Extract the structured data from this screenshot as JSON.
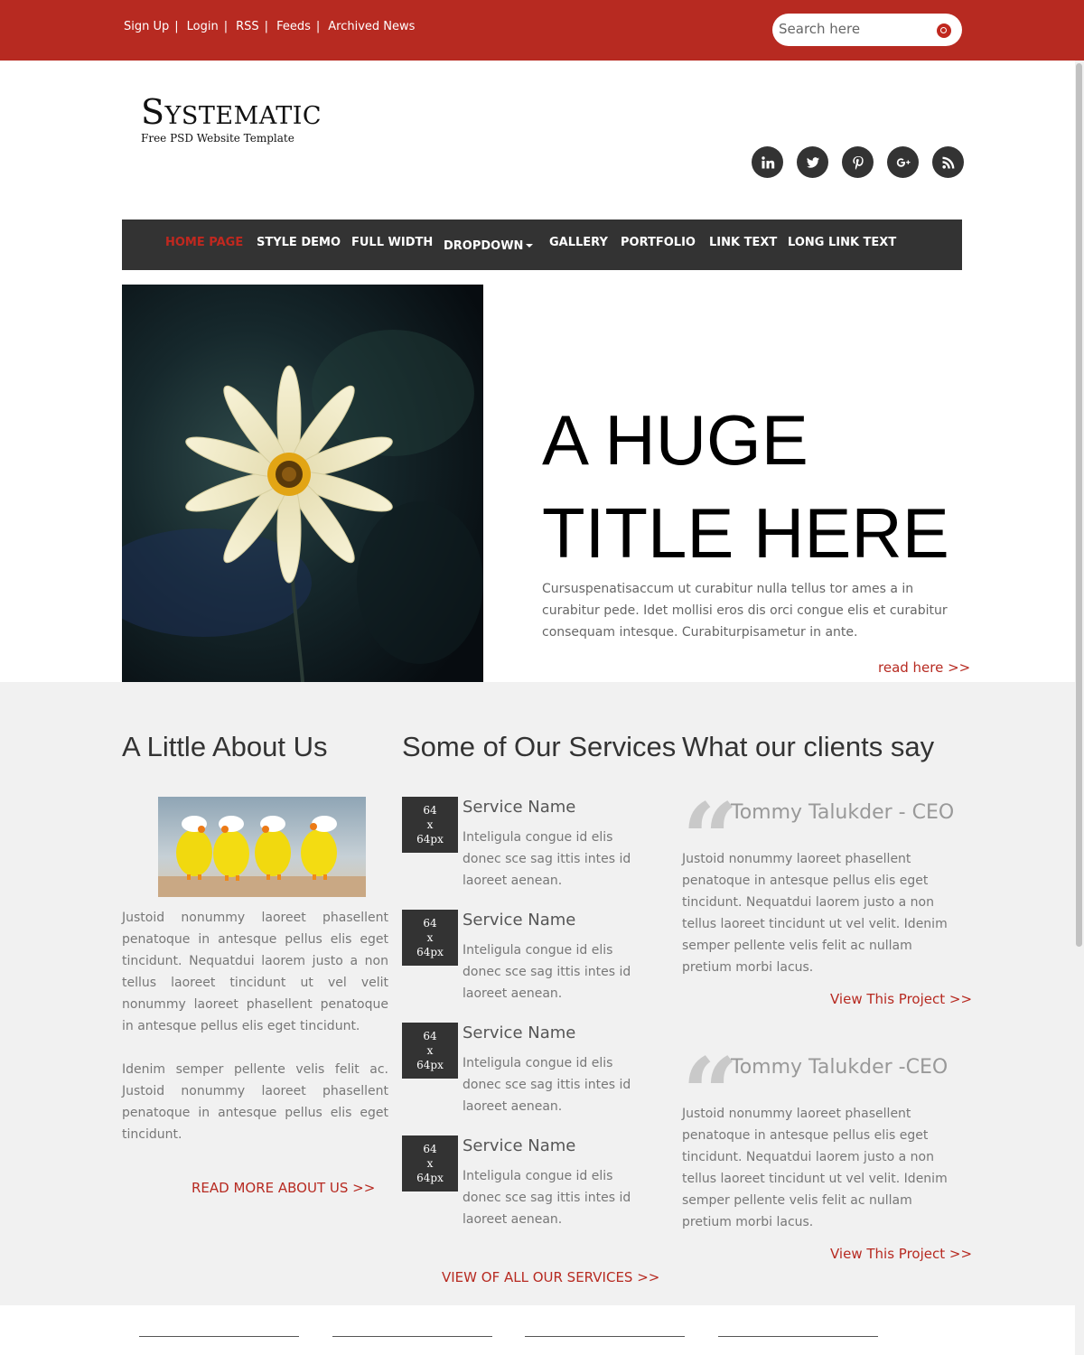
{
  "topbar": {
    "links": [
      "Sign Up",
      "Login",
      "RSS",
      "Feeds",
      "Archived News"
    ],
    "separator": "|",
    "search_placeholder": "Search here"
  },
  "header": {
    "logo_title": "Systematic",
    "logo_subtitle": "Free PSD Website Template",
    "social": [
      "linkedin-icon",
      "twitter-icon",
      "pinterest-icon",
      "google-plus-icon",
      "rss-icon"
    ]
  },
  "nav": {
    "items": [
      "HOME PAGE",
      "STYLE DEMO",
      "FULL WIDTH",
      "DROPDOWN",
      "GALLERY",
      "PORTFOLIO",
      "LINK TEXT",
      "LONG LINK TEXT"
    ],
    "active_index": 0
  },
  "hero": {
    "title_line1": "A HUGE",
    "title_line2": "TITLE HERE",
    "text": "Cursuspenatisaccum ut curabitur nulla tellus tor ames a in curabitur pede. Idet mollisi eros dis orci congue elis et curabitur consequam intesque. Curabiturpisametur in ante.",
    "read_more": "read here >>"
  },
  "about": {
    "title": "A Little About Us",
    "para1": "Justoid nonummy laoreet phasellent penatoque in antesque pellus elis eget tincidunt. Nequatdui laorem justo a non tellus laoreet tincidunt ut vel velit nonummy laoreet phasellent penatoque in antesque pellus elis eget tincidunt.",
    "para2": "Idenim semper pellente velis felit ac. Justoid nonummy laoreet phasellent penatoque in antesque pellus elis eget tincidunt.",
    "read_more": "READ MORE ABOUT US >>"
  },
  "services": {
    "title": "Some of Our Services",
    "thumb_lines": [
      "64",
      "x",
      "64px"
    ],
    "items": [
      {
        "name": "Service Name",
        "text": "Inteligula congue id elis donec sce sag ittis intes id laoreet aenean."
      },
      {
        "name": "Service Name",
        "text": "Inteligula congue id elis donec sce sag ittis intes id laoreet aenean."
      },
      {
        "name": "Service Name",
        "text": "Inteligula congue id elis donec sce sag ittis intes id laoreet aenean."
      },
      {
        "name": "Service Name",
        "text": "Inteligula congue id elis donec sce sag ittis intes id laoreet aenean."
      }
    ],
    "view_all": "VIEW OF ALL OUR SERVICES >>"
  },
  "testimonials": {
    "title": "What our clients say",
    "quote_glyph": "“",
    "items": [
      {
        "name": "Tommy Talukder - CEO",
        "text": "Justoid nonummy laoreet phasellent penatoque in antesque pellus elis eget tincidunt. Nequatdui laorem justo a non tellus laoreet tincidunt ut vel velit. Idenim semper pellente velis felit ac nullam pretium morbi lacus.",
        "more": "View This Project >>"
      },
      {
        "name": "Tommy Talukder -CEO",
        "text": "Justoid nonummy laoreet phasellent penatoque in antesque pellus elis eget tincidunt. Nequatdui laorem justo a non tellus laoreet tincidunt ut vel velit. Idenim semper pellente velis felit ac nullam pretium morbi lacus.",
        "more": "View This Project >>"
      }
    ]
  },
  "colors": {
    "brand_red": "#b72a21",
    "nav_bg": "#333333",
    "section_gray": "#f1f1f1"
  }
}
